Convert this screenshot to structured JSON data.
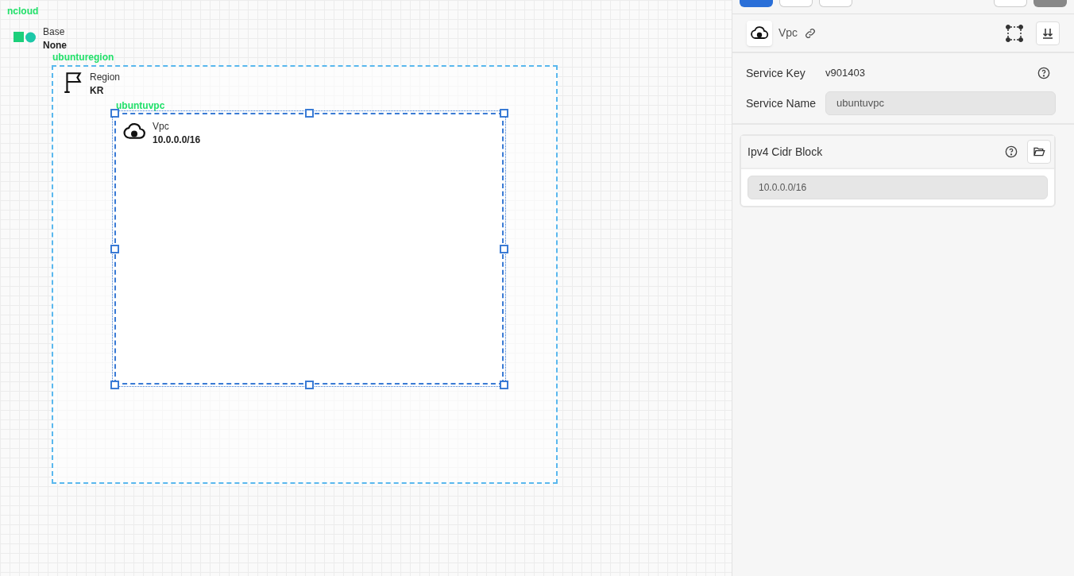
{
  "canvas": {
    "cloud_label": "ncloud",
    "base": {
      "title": "Base",
      "value": "None"
    },
    "region": {
      "label": "ubunturegion",
      "title": "Region",
      "value": "KR"
    },
    "vpc": {
      "label": "ubuntuvpc",
      "title": "Vpc",
      "value": "10.0.0.0/16",
      "selected": true
    }
  },
  "panel": {
    "header": {
      "title": "Vpc"
    },
    "fields": [
      {
        "label": "Service Key",
        "value": "v901403",
        "kind": "text"
      },
      {
        "label": "Service Name",
        "value": "ubuntuvpc",
        "kind": "input"
      }
    ],
    "section": {
      "title": "Ipv4 Cidr Block",
      "value": "10.0.0.0/16"
    }
  }
}
